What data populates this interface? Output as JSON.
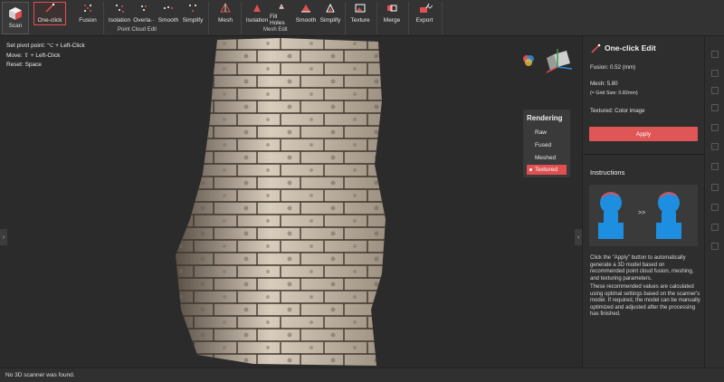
{
  "toolbar": {
    "scan": "Scan",
    "one_click": "One-click",
    "fusion": "Fusion",
    "isolation": "Isolation",
    "overlap": "Overla··",
    "smooth": "Smooth",
    "simplify": "Simplify",
    "mesh": "Mesh",
    "isolation2": "Isolation",
    "fill_holes": "Fill Holes",
    "smooth2": "Smooth",
    "simplify2": "Simplify",
    "texture": "Texture",
    "merge": "Merge",
    "export": "Export",
    "group_point_cloud": "Point Cloud Edit",
    "group_mesh": "Mesh Edit"
  },
  "viewport": {
    "hint1": "Set pivot point: ⌥ + Left-Click",
    "hint2": "Move: ⇧ + Left-Click",
    "hint3": "Reset: Space",
    "left_arrow": "›",
    "right_arrow": "›"
  },
  "rendering": {
    "title": "Rendering",
    "options": [
      "Raw",
      "Fused",
      "Meshed",
      "Textured"
    ],
    "selected": "Textured"
  },
  "panel": {
    "title": "One-click Edit",
    "fusion": "Fusion:  0.52 (mm)",
    "mesh": "Mesh:  5.80",
    "grid": "(≈ Grid Size: 0.82mm)",
    "textured": "Textured: Color image",
    "apply": "Apply",
    "instructions": "Instructions",
    "arrows": ">>",
    "para1": "Click the \"Apply\" button to automatically generate a 3D model based on recommended point cloud fusion, meshing, and texturing parameters.",
    "para2": "These recommended values are calculated using optimal settings based on the scanner's model. If required, the model can be manually optimized and adjusted after the processing has finished."
  },
  "status": "No 3D scanner was found.",
  "colors": {
    "accent": "#e05050",
    "bg": "#2b2b2b",
    "model": "#1e8fe0"
  }
}
